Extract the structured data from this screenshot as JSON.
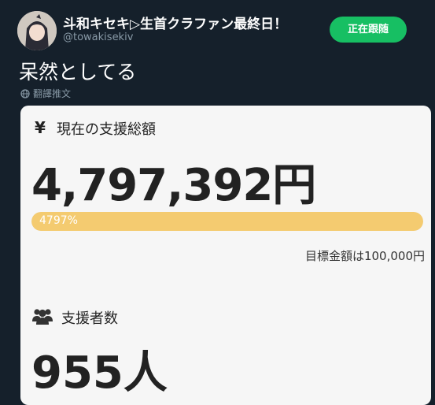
{
  "tweet": {
    "author_name": "斗和キセキ▷生首クラファン最終日！",
    "handle": "@towakisekiv",
    "follow_label": "正在跟随",
    "text": "呆然としてる",
    "translate_label": "翻譯推文",
    "avatar_icon": "anime-avatar-icon"
  },
  "card": {
    "total_icon": "yen-icon",
    "total_symbol": "¥",
    "total_label": "現在の支援総額",
    "total_amount": "4,797,392円",
    "progress_text": "4797%",
    "progress_fraction": 1.0,
    "goal_text": "目標金額は100,000円",
    "supporters_icon": "users-icon",
    "supporters_label": "支援者数",
    "supporters_count": "955人"
  },
  "colors": {
    "background": "#15202b",
    "follow_button": "#17bf63",
    "progress_fill": "#f4cb70",
    "card_background": "#f6f6f6"
  }
}
